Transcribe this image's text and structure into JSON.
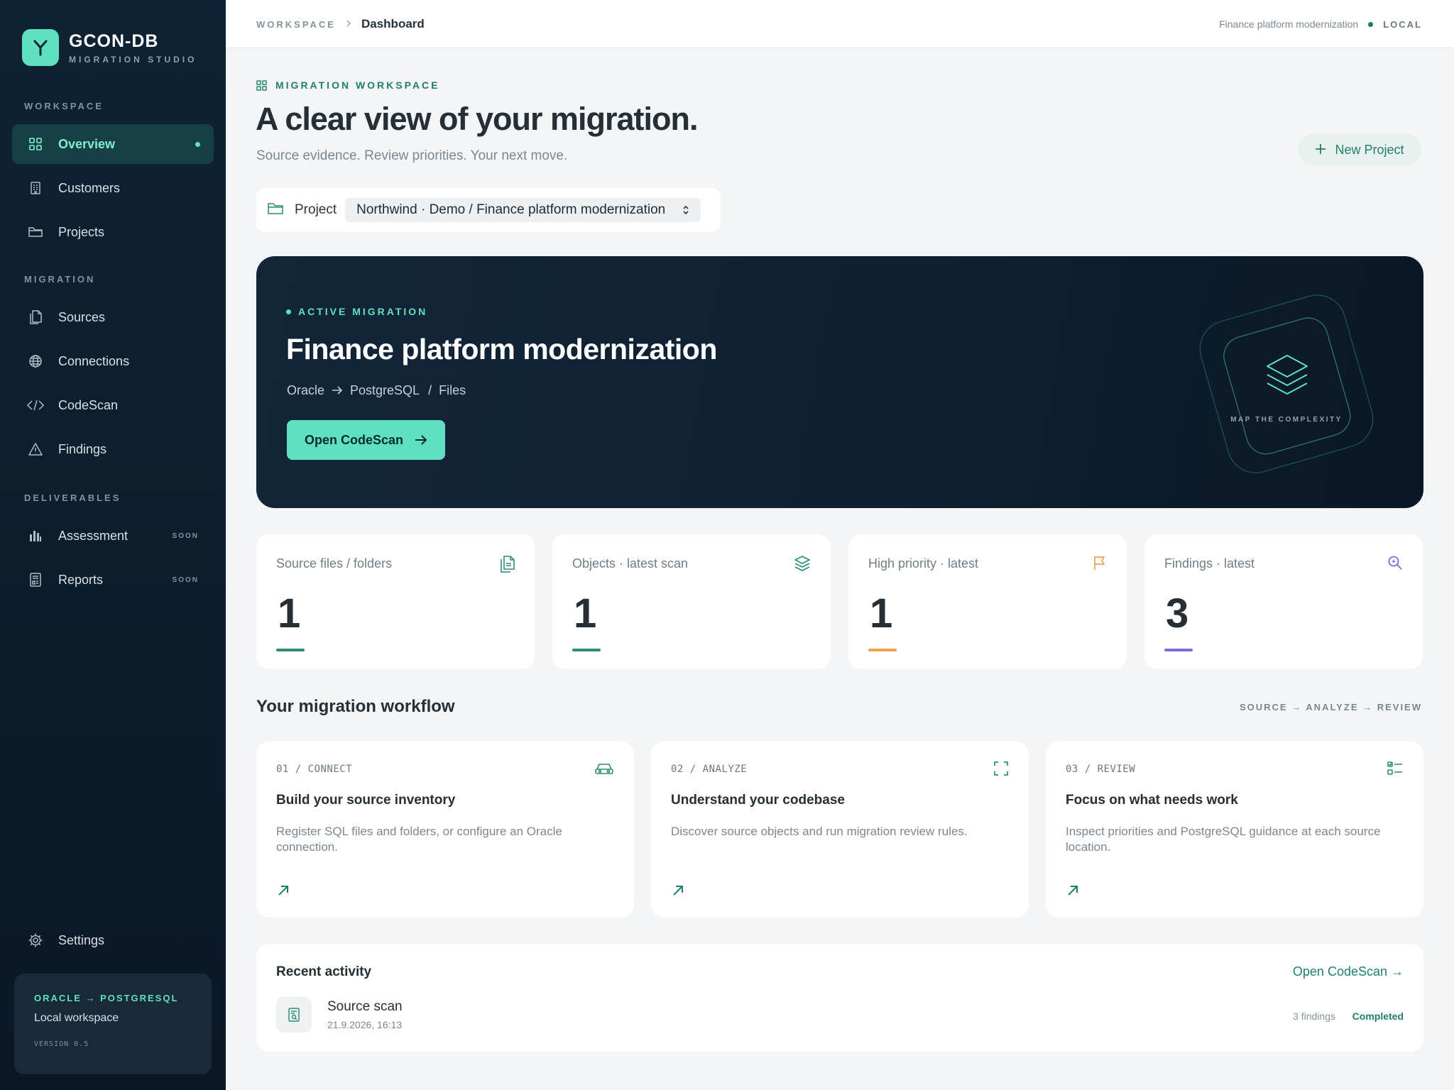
{
  "brand": {
    "name": "GCON-DB",
    "subtitle": "MIGRATION STUDIO"
  },
  "sidebar": {
    "sections": [
      "WORKSPACE",
      "MIGRATION",
      "DELIVERABLES"
    ],
    "items": [
      {
        "label": "Overview",
        "icon": "grid-icon",
        "active": true
      },
      {
        "label": "Customers",
        "icon": "building-icon"
      },
      {
        "label": "Projects",
        "icon": "folder-icon"
      },
      {
        "label": "Sources",
        "icon": "files-icon"
      },
      {
        "label": "Connections",
        "icon": "globe-icon"
      },
      {
        "label": "CodeScan",
        "icon": "code-icon"
      },
      {
        "label": "Findings",
        "icon": "warning-icon"
      },
      {
        "label": "Assessment",
        "icon": "bar-chart-icon",
        "badge": "SOON"
      },
      {
        "label": "Reports",
        "icon": "report-icon",
        "badge": "SOON"
      },
      {
        "label": "Settings",
        "icon": "gear-icon"
      }
    ],
    "card": {
      "title": "ORACLE → POSTGRESQL",
      "subtitle": "Local workspace",
      "version": "VERSION 0.5"
    }
  },
  "topbar": {
    "breadcrumb_root": "WORKSPACE",
    "breadcrumb_current": "Dashboard",
    "project_name": "Finance platform modernization",
    "environment": "LOCAL"
  },
  "header": {
    "eyebrow": "MIGRATION WORKSPACE",
    "title": "A clear view of your migration.",
    "lede": "Source evidence. Review priorities. Your next move.",
    "new_project_label": "New Project"
  },
  "project_picker": {
    "label": "Project",
    "selected": "Northwind · Demo / Finance platform modernization"
  },
  "hero": {
    "tag": "ACTIVE MIGRATION",
    "title": "Finance platform modernization",
    "source": "Oracle",
    "target": "PostgreSQL",
    "slash": "/",
    "scope": "Files",
    "button_label": "Open CodeScan",
    "art_caption": "MAP THE COMPLEXITY"
  },
  "stats": [
    {
      "label": "Source files / folders",
      "value": "1",
      "icon": "files-icon",
      "color": "#2f8c78"
    },
    {
      "label": "Objects · latest scan",
      "value": "1",
      "icon": "layers-icon",
      "color": "#2f8c78"
    },
    {
      "label": "High priority · latest",
      "value": "1",
      "icon": "flag-icon",
      "color": "#f0a04b"
    },
    {
      "label": "Findings · latest",
      "value": "3",
      "icon": "search-icon",
      "color": "#7d6be0"
    }
  ],
  "workflow": {
    "title": "Your migration workflow",
    "subtitle": "SOURCE → ANALYZE → REVIEW",
    "steps": [
      {
        "step": "01 / CONNECT",
        "title": "Build your source inventory",
        "desc": "Register SQL files and folders, or configure an Oracle connection.",
        "icon": "database-car-icon"
      },
      {
        "step": "02 / ANALYZE",
        "title": "Understand your codebase",
        "desc": "Discover source objects and run migration review rules.",
        "icon": "scan-frame-icon"
      },
      {
        "step": "03 / REVIEW",
        "title": "Focus on what needs work",
        "desc": "Inspect priorities and PostgreSQL guidance at each source location.",
        "icon": "checklist-icon"
      }
    ]
  },
  "activity": {
    "title": "Recent activity",
    "link_label": "Open CodeScan →",
    "items": [
      {
        "name": "Source scan",
        "time": "21.9.2026, 16:13",
        "count": "3 findings",
        "status": "Completed"
      }
    ]
  },
  "colors": {
    "accent": "#5fe0bf",
    "accent_dark": "#1f7f6c",
    "sidebar_bg": "#0f2233",
    "hero_bg": "#132538"
  }
}
